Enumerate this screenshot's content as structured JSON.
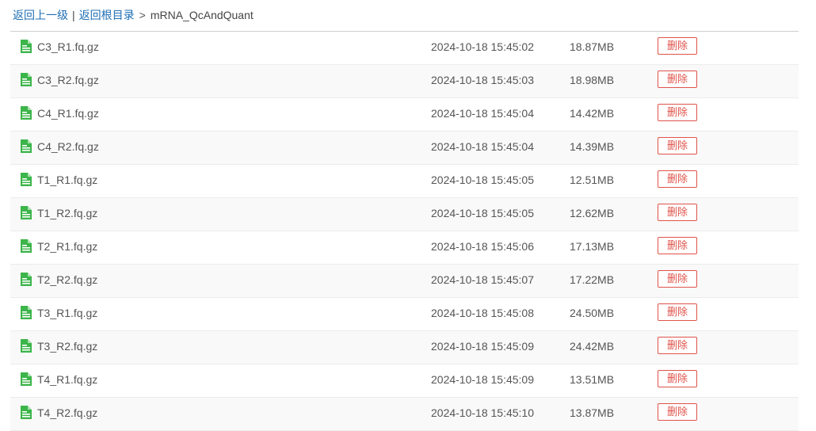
{
  "breadcrumb": {
    "back_up": "返回上一级",
    "separator": "|",
    "back_root": "返回根目录",
    "arrow": ">",
    "current": "mRNA_QcAndQuant"
  },
  "colors": {
    "link": "#1f6fb5",
    "delete": "#e0534a",
    "file_icon": "#3cb54a"
  },
  "files": [
    {
      "name": "C3_R1.fq.gz",
      "time": "2024-10-18 15:45:02",
      "size": "18.87MB",
      "action": "删除",
      "icon": "file-icon"
    },
    {
      "name": "C3_R2.fq.gz",
      "time": "2024-10-18 15:45:03",
      "size": "18.98MB",
      "action": "删除",
      "icon": "file-icon"
    },
    {
      "name": "C4_R1.fq.gz",
      "time": "2024-10-18 15:45:04",
      "size": "14.42MB",
      "action": "删除",
      "icon": "file-icon"
    },
    {
      "name": "C4_R2.fq.gz",
      "time": "2024-10-18 15:45:04",
      "size": "14.39MB",
      "action": "删除",
      "icon": "file-icon"
    },
    {
      "name": "T1_R1.fq.gz",
      "time": "2024-10-18 15:45:05",
      "size": "12.51MB",
      "action": "删除",
      "icon": "file-icon"
    },
    {
      "name": "T1_R2.fq.gz",
      "time": "2024-10-18 15:45:05",
      "size": "12.62MB",
      "action": "删除",
      "icon": "file-icon"
    },
    {
      "name": "T2_R1.fq.gz",
      "time": "2024-10-18 15:45:06",
      "size": "17.13MB",
      "action": "删除",
      "icon": "file-icon"
    },
    {
      "name": "T2_R2.fq.gz",
      "time": "2024-10-18 15:45:07",
      "size": "17.22MB",
      "action": "删除",
      "icon": "file-icon"
    },
    {
      "name": "T3_R1.fq.gz",
      "time": "2024-10-18 15:45:08",
      "size": "24.50MB",
      "action": "删除",
      "icon": "file-icon"
    },
    {
      "name": "T3_R2.fq.gz",
      "time": "2024-10-18 15:45:09",
      "size": "24.42MB",
      "action": "删除",
      "icon": "file-icon"
    },
    {
      "name": "T4_R1.fq.gz",
      "time": "2024-10-18 15:45:09",
      "size": "13.51MB",
      "action": "删除",
      "icon": "file-icon"
    },
    {
      "name": "T4_R2.fq.gz",
      "time": "2024-10-18 15:45:10",
      "size": "13.87MB",
      "action": "删除",
      "icon": "file-icon"
    }
  ]
}
